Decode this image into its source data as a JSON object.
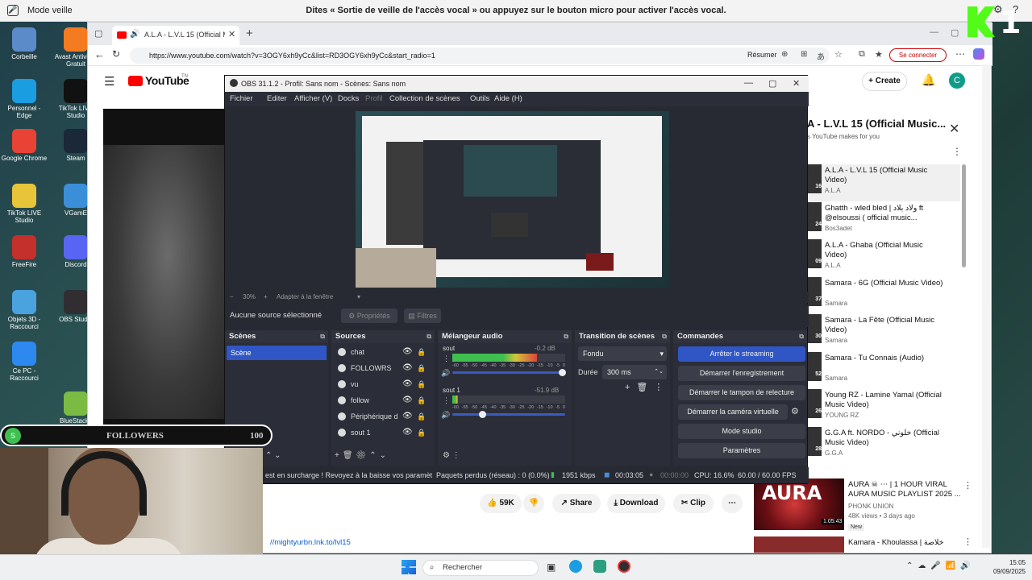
{
  "voice": {
    "mode": "Mode veille",
    "message": "Dites « Sortie de veille de l'accès vocal » ou appuyez sur le bouton micro pour activer l'accès vocal."
  },
  "overlay_logo": {
    "number": "1"
  },
  "desktop_icons": [
    {
      "label": "Corbeille",
      "color": "#5b8bc9"
    },
    {
      "label": "Avast Antivirus Gratuit",
      "color": "#f47b20"
    },
    {
      "label": "Personnel - Edge",
      "color": "#1b9de2"
    },
    {
      "label": "TikTok LIVE Studio",
      "color": "#111111"
    },
    {
      "label": "Google Chrome",
      "color": "#e94335"
    },
    {
      "label": "Steam",
      "color": "#1b2838"
    },
    {
      "label": "TikTok LIVE Studio",
      "color": "#e8c43a"
    },
    {
      "label": "VGamE",
      "color": "#3b8fd9"
    },
    {
      "label": "FreeFire",
      "color": "#c4302b"
    },
    {
      "label": "Discord",
      "color": "#5865f2"
    },
    {
      "label": "Objets 3D - Raccourci",
      "color": "#4aa3df"
    },
    {
      "label": "OBS Studio",
      "color": "#302e31"
    },
    {
      "label": "Ce PC - Raccourci",
      "color": "#2d89ef"
    },
    {
      "label": "BlueStacks",
      "color": "#7bbb44"
    }
  ],
  "browser": {
    "tab_title": "A.L.A - L.V.L 15 (Official Mus",
    "url": "https://www.youtube.com/watch?v=3OGY6xh9yCc&list=RD3OGY6xh9yCc&start_radio=1",
    "resumer": "Résumer",
    "se_connecter": "Se connecter"
  },
  "youtube": {
    "logo": "YouTube",
    "logo_sup": "TN",
    "create": "Create",
    "avatar_letter": "C",
    "playlist_title": "A - L.V.L 15 (Official Music...",
    "playlist_sub": "s YouTube makes for you",
    "playlist": [
      {
        "title": "A.L.A - L.V.L 15 (Official Music Video)",
        "channel": "A.L.A",
        "duration": "16"
      },
      {
        "title": "Ghatth - wled bled | ولاد بلاد ft @elsoussi ( official music...",
        "channel": "Bos3adet",
        "duration": "24"
      },
      {
        "title": "A.L.A - Ghaba (Official Music Video)",
        "channel": "A.L.A",
        "duration": "09"
      },
      {
        "title": "Samara - 6G (Official Music Video)",
        "channel": "Samara",
        "duration": "37"
      },
      {
        "title": "Samara - La Fête (Official Music Video)",
        "channel": "Samara",
        "duration": "30"
      },
      {
        "title": "Samara - Tu Connais (Audio)",
        "channel": "Samara",
        "duration": "52"
      },
      {
        "title": "Young RZ - Lamine Yamal (Official Music Video)",
        "channel": "YOUNG RZ",
        "duration": "26"
      },
      {
        "title": "G.G.A ft. NORDO - خلوني (Official Music Video)",
        "channel": "G.G.A",
        "duration": "28"
      }
    ],
    "actions": {
      "likes": "59K",
      "share": "Share",
      "download": "Download",
      "clip": "Clip"
    },
    "desc_link": "//mightyurbn.lnk.to/lvl15",
    "rec1": {
      "title": "AURA ☠ ⋯ | 1 HOUR VIRAL AURA MUSIC PLAYLIST 2025 ...",
      "channel": "PHONK UNION",
      "meta": "48K views • 3 days ago",
      "badge": "New",
      "duration": "1:05:43",
      "thumb_text": "AURA"
    },
    "rec2": {
      "title": "Kamara - Khoulassa | خلاصة"
    }
  },
  "obs": {
    "title": "OBS 31.1.2 - Profil: Sans nom - Scènes: Sans nom",
    "menu": [
      "Fichier",
      "Editer",
      "Afficher (V)",
      "Docks",
      "Profil",
      "Collection de scènes",
      "Outils",
      "Aide (H)"
    ],
    "zoom": "30%",
    "fit": "Adapter à la fenêtre",
    "no_source": "Aucune source sélectionné",
    "properties": "Propriétés",
    "filters": "Filtres",
    "scenes_header": "Scènes",
    "scenes": [
      "Scène"
    ],
    "sources_header": "Sources",
    "sources": [
      "chat",
      "FOLLOWRS",
      "vu",
      "follow",
      "Périphérique d",
      "sout 1"
    ],
    "mixer_header": "Mélangeur audio",
    "mixer": [
      {
        "name": "sout",
        "db": "-0.2 dB",
        "level": 0.75,
        "volume": 1.0
      },
      {
        "name": "sout 1",
        "db": "-51.9 dB",
        "level": 0.05,
        "volume": 0.25
      }
    ],
    "meter_scale": [
      "-60",
      "-55",
      "-50",
      "-45",
      "-40",
      "-35",
      "-30",
      "-25",
      "-20",
      "-15",
      "-10",
      "-5",
      "0"
    ],
    "transitions_header": "Transition de scènes",
    "transition": "Fondu",
    "duration_label": "Durée",
    "duration_value": "300 ms",
    "commands_header": "Commandes",
    "commands": [
      "Arrêter le streaming",
      "Démarrer l'enregistrement",
      "Démarrer le tampon de relecture",
      "Démarrer la caméra virtuelle",
      "Mode studio",
      "Paramètres"
    ],
    "status": {
      "warning": "est en surcharge ! Revoyez à la baisse vos paramèt",
      "dropped": "Paquets perdus (réseau) : 0 (0.0%)",
      "bitrate": "1951 kbps",
      "live_time": "00:03:05",
      "rec_time": "00:00:00",
      "cpu": "CPU: 16.6%",
      "fps": "60.00 / 60.00 FPS"
    }
  },
  "followers_bar": {
    "label": "FOLLOWERS",
    "count": "100",
    "icon_letter": "S"
  },
  "taskbar": {
    "search": "Rechercher",
    "time": "15:05",
    "date": "09/09/2025"
  }
}
